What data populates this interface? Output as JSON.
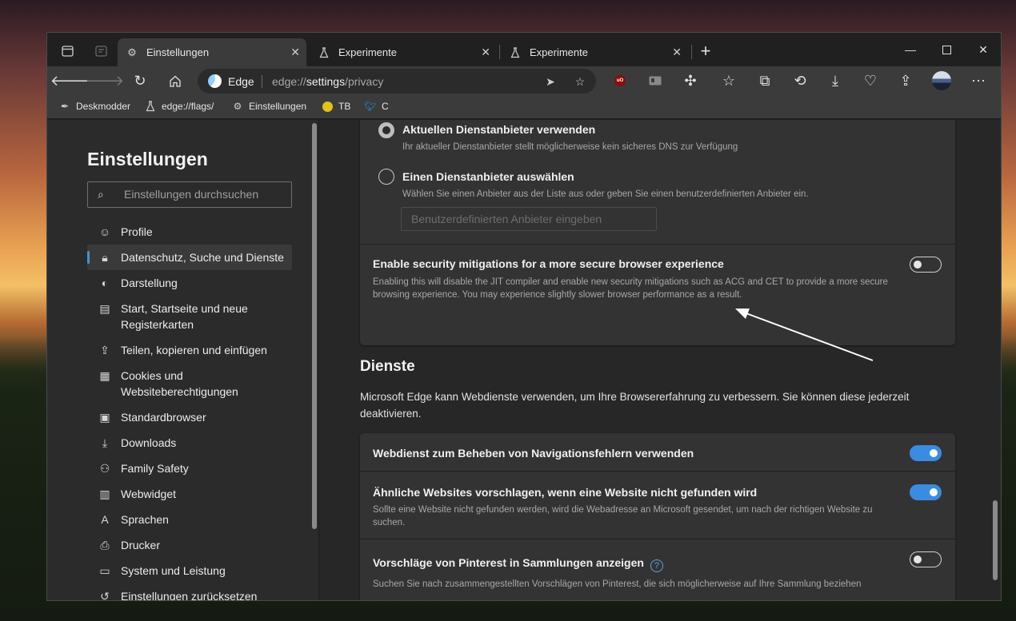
{
  "tabs": [
    {
      "label": "Einstellungen",
      "icon": "gear-icon",
      "active": true
    },
    {
      "label": "Experimente",
      "icon": "flask-icon",
      "active": false
    },
    {
      "label": "Experimente",
      "icon": "flask-icon",
      "active": false
    }
  ],
  "address": {
    "brand": "Edge",
    "url_prefix": "edge://",
    "url_host": "settings",
    "url_path": "/privacy"
  },
  "favorites": [
    {
      "label": "Deskmodder",
      "icon": "pen-icon"
    },
    {
      "label": "edge://flags/",
      "icon": "flask-icon"
    },
    {
      "label": "Einstellungen",
      "icon": "gear-icon"
    },
    {
      "label": "TB",
      "icon": "tb-icon"
    },
    {
      "label": "C",
      "icon": "twitter-icon"
    }
  ],
  "sidebar": {
    "title": "Einstellungen",
    "search_placeholder": "Einstellungen durchsuchen",
    "items": [
      {
        "label": "Profile"
      },
      {
        "label": "Datenschutz, Suche und Dienste"
      },
      {
        "label": "Darstellung"
      },
      {
        "label": "Start, Startseite und neue Registerkarten"
      },
      {
        "label": "Teilen, kopieren und einfügen"
      },
      {
        "label": "Cookies und Websiteberechtigungen"
      },
      {
        "label": "Standardbrowser"
      },
      {
        "label": "Downloads"
      },
      {
        "label": "Family Safety"
      },
      {
        "label": "Webwidget"
      },
      {
        "label": "Sprachen"
      },
      {
        "label": "Drucker"
      },
      {
        "label": "System und Leistung"
      },
      {
        "label": "Einstellungen zurücksetzen"
      }
    ]
  },
  "dns": {
    "option1_title": "Aktuellen Dienstanbieter verwenden",
    "option1_desc": "Ihr aktueller Dienstanbieter stellt möglicherweise kein sicheres DNS zur Verfügung",
    "option1_selected": true,
    "option2_title": "Einen Dienstanbieter auswählen",
    "option2_desc": "Wählen Sie einen Anbieter aus der Liste aus oder geben Sie einen benutzerdefinierten Anbieter ein.",
    "option2_selected": false,
    "provider_placeholder": "Benutzerdefinierten Anbieter eingeben"
  },
  "security": {
    "title": "Enable security mitigations for a more secure browser experience",
    "desc": "Enabling this will disable the JIT compiler and enable new security mitigations such as ACG and CET to provide a more secure browsing experience. You may experience slightly slower browser performance as a result.",
    "enabled": false
  },
  "services": {
    "title": "Dienste",
    "desc": "Microsoft Edge kann Webdienste verwenden, um Ihre Browsererfahrung zu verbessern. Sie können diese jederzeit deaktivieren.",
    "items": [
      {
        "title": "Webdienst zum Beheben von Navigationsfehlern verwenden",
        "desc": "",
        "enabled": true
      },
      {
        "title": "Ähnliche Websites vorschlagen, wenn eine Website nicht gefunden wird",
        "desc": "Sollte eine Website nicht gefunden werden, wird die Webadresse an Microsoft gesendet, um nach der richtigen Website zu suchen.",
        "enabled": true
      },
      {
        "title": "Vorschläge von Pinterest in Sammlungen anzeigen",
        "desc": "Suchen Sie nach zusammengestellten Vorschlägen von Pinterest, die sich möglicherweise auf Ihre Sammlung beziehen",
        "enabled": false
      }
    ]
  },
  "colors": {
    "accent": "#3b8be0",
    "window_bg": "#202020",
    "card_bg": "#333333"
  }
}
